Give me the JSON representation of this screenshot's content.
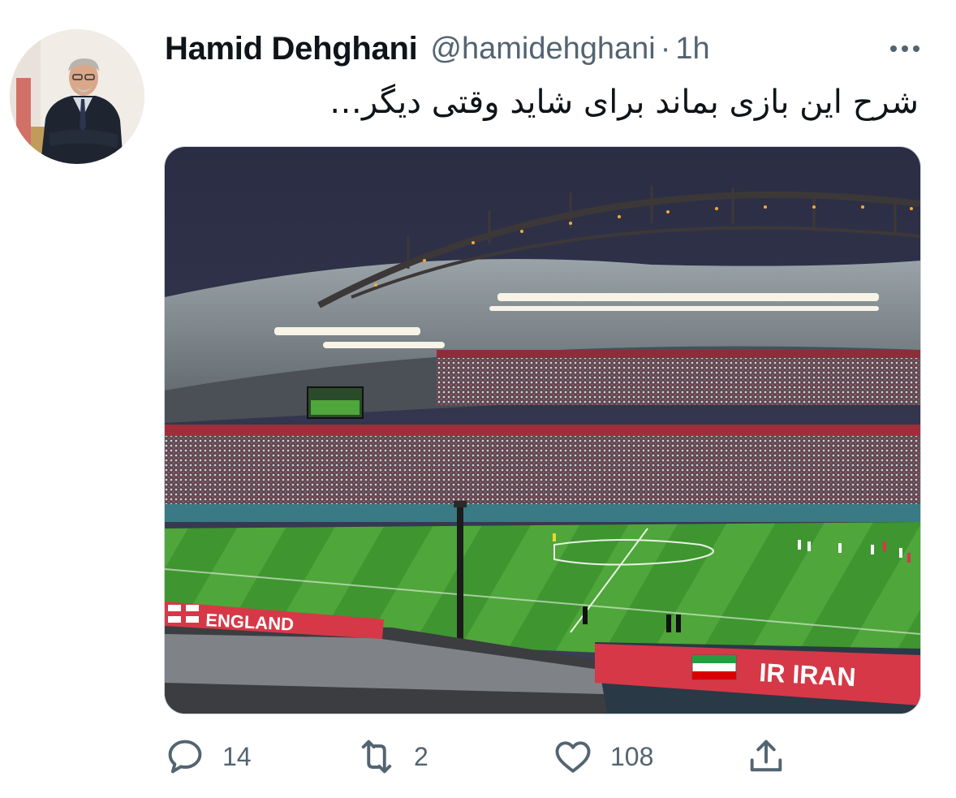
{
  "author": {
    "name": "Hamid Dehghani",
    "handle": "@hamidehghani",
    "separator": "·",
    "time": "1h"
  },
  "tweet": {
    "text": "شرح این بازی بماند برای شاید وقتی دیگر…"
  },
  "media": {
    "banners": {
      "left": "ENGLAND",
      "right": "IR IRAN"
    }
  },
  "actions": {
    "replies": "14",
    "retweets": "2",
    "likes": "108"
  },
  "colors": {
    "text": "#0f1419",
    "secondary": "#536471",
    "border": "#cfd9de"
  },
  "icons": [
    "more-icon",
    "reply-icon",
    "retweet-icon",
    "like-icon",
    "share-icon"
  ]
}
